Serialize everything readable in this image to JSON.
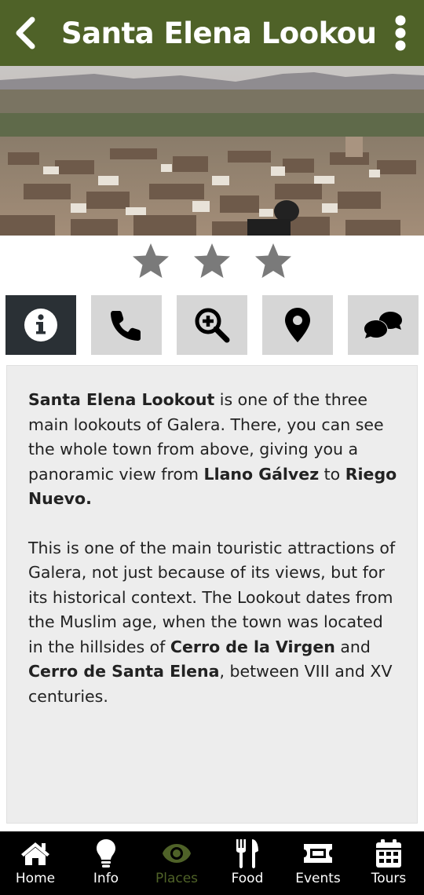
{
  "header": {
    "title": "Santa Elena Lookout",
    "back_icon": "chevron-left-icon",
    "menu_icon": "vertical-ellipsis-icon",
    "color": "#4f6228"
  },
  "rating": {
    "stars": 3,
    "max": 3,
    "color": "#7a7a7a"
  },
  "tabs": [
    {
      "icon": "info-icon",
      "active": true
    },
    {
      "icon": "phone-icon",
      "active": false
    },
    {
      "icon": "zoom-in-icon",
      "active": false
    },
    {
      "icon": "map-marker-icon",
      "active": false
    },
    {
      "icon": "comments-icon",
      "active": false
    }
  ],
  "description": {
    "p1": {
      "b1": "Santa Elena Lookout",
      "t1": " is one of the three main lookouts of Galera. There, you can see the whole town from above, giving you a panoramic view from ",
      "b2": "Llano Gálvez",
      "t2": " to ",
      "b3": "Riego Nuevo."
    },
    "p2": {
      "t1": "This is one of the main touristic attractions of Galera, not just because of its views, but for its historical context. The Lookout dates from the Muslim age, when the town was located in the hillsides of ",
      "b1": "Cerro de la Virgen",
      "t2": " and ",
      "b2": "Cerro de Santa Elena",
      "t3": ", between VIII and XV centuries."
    }
  },
  "bottom_nav": {
    "active_color": "#4f6228",
    "items": [
      {
        "label": "Home",
        "icon": "home-icon"
      },
      {
        "label": "Info",
        "icon": "lightbulb-icon"
      },
      {
        "label": "Places",
        "icon": "eye-icon",
        "active": true
      },
      {
        "label": "Food",
        "icon": "utensils-icon"
      },
      {
        "label": "Events",
        "icon": "ticket-icon"
      },
      {
        "label": "Tours",
        "icon": "calendar-icon"
      }
    ]
  }
}
